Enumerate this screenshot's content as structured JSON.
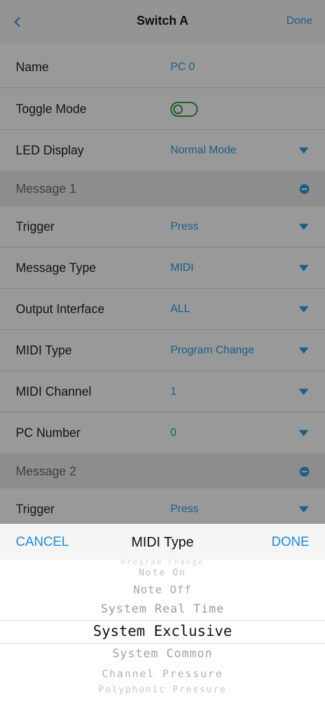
{
  "nav": {
    "title": "Switch A",
    "done_label": "Done",
    "back_icon": "chevron-left-icon"
  },
  "rows": {
    "name": {
      "label": "Name",
      "value": "PC 0"
    },
    "toggle_mode": {
      "label": "Toggle Mode",
      "state": "off"
    },
    "led_display": {
      "label": "LED Display",
      "value": "Normal Mode"
    }
  },
  "message1": {
    "header": "Message 1",
    "trigger": {
      "label": "Trigger",
      "value": "Press"
    },
    "message_type": {
      "label": "Message Type",
      "value": "MIDI"
    },
    "output_interface": {
      "label": "Output Interface",
      "value": "ALL"
    },
    "midi_type": {
      "label": "MIDI Type",
      "value": "Program Change"
    },
    "midi_channel": {
      "label": "MIDI Channel",
      "value": "1"
    },
    "pc_number": {
      "label": "PC Number",
      "value": "0"
    }
  },
  "message2": {
    "header": "Message 2",
    "trigger": {
      "label": "Trigger",
      "value": "Press"
    }
  },
  "picker": {
    "cancel_label": "CANCEL",
    "title": "MIDI Type",
    "done_label": "DONE",
    "options": [
      "Program Change",
      "Note On",
      "Note Off",
      "System Real Time",
      "System Exclusive",
      "System Common",
      "Channel Pressure",
      "Polyphonic Pressure"
    ],
    "selected": "System Exclusive"
  },
  "colors": {
    "accent": "#2b9fe0",
    "toggle_green": "#2f9e44",
    "section_bg": "#ebebeb",
    "picker_accent": "#1e8ae0"
  }
}
